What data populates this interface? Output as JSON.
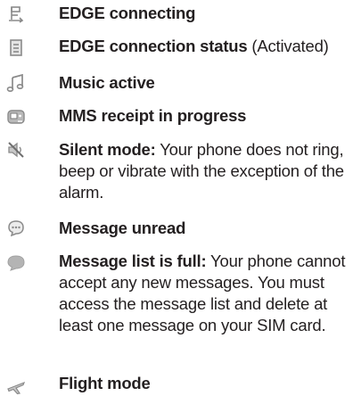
{
  "entries": [
    {
      "icon": "edge-connecting-icon",
      "term": "EDGE connecting",
      "desc": ""
    },
    {
      "icon": "edge-status-icon",
      "term": "EDGE connection status",
      "desc": " (Activated)"
    },
    {
      "icon": "music-note-icon",
      "term": "Music active",
      "desc": ""
    },
    {
      "icon": "mms-receipt-icon",
      "term": "MMS receipt in progress",
      "desc": ""
    },
    {
      "icon": "silent-mode-icon",
      "term": "Silent mode:",
      "desc": " Your phone does not ring, beep or vibrate with the exception of the alarm."
    },
    {
      "icon": "message-unread-icon",
      "term": "Message unread",
      "desc": ""
    },
    {
      "icon": "message-list-full-icon",
      "term": "Message list is full:",
      "desc": " Your phone cannot accept any new messages. You must access the message list and delete at least one message on your SIM card."
    },
    {
      "icon": "flight-mode-icon",
      "term": "Flight mode",
      "desc": ""
    }
  ],
  "colors": {
    "text": "#231f20",
    "icon_stroke": "#8a8a8a",
    "icon_fill": "#c8c8c8"
  }
}
